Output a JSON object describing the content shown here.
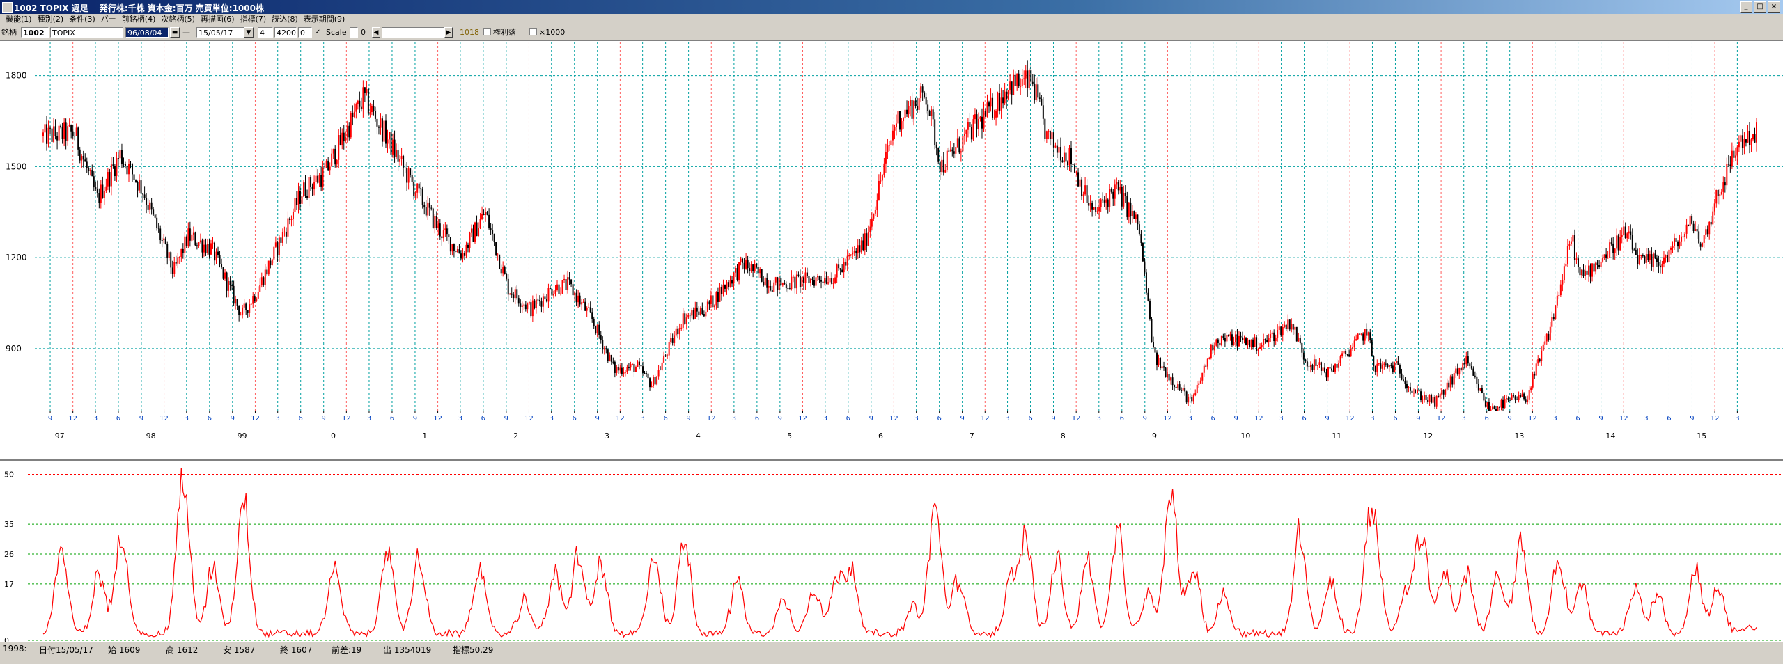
{
  "window": {
    "title": "1002 TOPIX 週足　 発行株:千株 資本金:百万 売買単位:1000株"
  },
  "menu": [
    "機能(1)",
    "種別(2)",
    "条件(3)",
    "バー",
    "前銘柄(4)",
    "次銘柄(5)",
    "再描画(6)",
    "指標(7)",
    "読込(8)",
    "表示期間(9)"
  ],
  "toolbar": {
    "code_label": "銘柄",
    "code": "1002",
    "name": "TOPIX",
    "start_date": "96/08/04",
    "end_date": "15/05/17",
    "field1": "4",
    "field2": "4200",
    "field3": "0",
    "scale_label": "Scale",
    "scale_value": "0",
    "count": "1018",
    "rights_label": "権利落",
    "x1000_label": "×1000"
  },
  "colors": {
    "up": "#ff0000",
    "down": "#000000",
    "grid_h": "#00a0a0",
    "grid_v": "#00a0a0",
    "sub_line": "#ff0000",
    "sub_grid": "#00a000",
    "sub_top_grid": "#ff0000"
  },
  "chart_data": [
    {
      "type": "candlestick",
      "title": "",
      "ylim": [
        700,
        1900
      ],
      "yticks": [
        900,
        1200,
        1500,
        1800
      ],
      "start_date": "1996-08-04",
      "end_date": "2015-05-17",
      "year_labels": [
        "97",
        "98",
        "99",
        "0",
        "1",
        "2",
        "3",
        "4",
        "5",
        "6",
        "7",
        "8",
        "9",
        "10",
        "11",
        "12",
        "13",
        "14",
        "15"
      ],
      "month_labels": [
        "9",
        "12",
        "3",
        "6"
      ],
      "keypoints": [
        [
          "1996-08",
          1600
        ],
        [
          "1996-12",
          1610
        ],
        [
          "1997-03",
          1390
        ],
        [
          "1997-06",
          1540
        ],
        [
          "1997-09",
          1420
        ],
        [
          "1998-01",
          1150
        ],
        [
          "1998-03",
          1270
        ],
        [
          "1998-06",
          1230
        ],
        [
          "1998-10",
          1010
        ],
        [
          "1998-12",
          1090
        ],
        [
          "1999-03",
          1250
        ],
        [
          "1999-06",
          1420
        ],
        [
          "1999-09",
          1480
        ],
        [
          "2000-02",
          1730
        ],
        [
          "2000-05",
          1600
        ],
        [
          "2000-08",
          1460
        ],
        [
          "2000-12",
          1290
        ],
        [
          "2001-03",
          1210
        ],
        [
          "2001-06",
          1350
        ],
        [
          "2001-09",
          1100
        ],
        [
          "2001-12",
          1030
        ],
        [
          "2002-03",
          1100
        ],
        [
          "2002-05",
          1110
        ],
        [
          "2002-08",
          1000
        ],
        [
          "2002-11",
          830
        ],
        [
          "2003-02",
          840
        ],
        [
          "2003-04",
          780
        ],
        [
          "2003-08",
          1000
        ],
        [
          "2003-11",
          1030
        ],
        [
          "2004-04",
          1180
        ],
        [
          "2004-08",
          1110
        ],
        [
          "2004-11",
          1120
        ],
        [
          "2005-04",
          1140
        ],
        [
          "2005-08",
          1250
        ],
        [
          "2005-12",
          1650
        ],
        [
          "2006-04",
          1740
        ],
        [
          "2006-06",
          1500
        ],
        [
          "2006-10",
          1620
        ],
        [
          "2007-01",
          1700
        ],
        [
          "2007-03",
          1770
        ],
        [
          "2007-06",
          1780
        ],
        [
          "2007-08",
          1590
        ],
        [
          "2007-11",
          1530
        ],
        [
          "2008-02",
          1340
        ],
        [
          "2008-05",
          1430
        ],
        [
          "2008-08",
          1300
        ],
        [
          "2008-10",
          870
        ],
        [
          "2009-03",
          720
        ],
        [
          "2009-06",
          930
        ],
        [
          "2009-09",
          930
        ],
        [
          "2009-12",
          910
        ],
        [
          "2010-04",
          990
        ],
        [
          "2010-06",
          860
        ],
        [
          "2010-09",
          820
        ],
        [
          "2011-02",
          960
        ],
        [
          "2011-03",
          840
        ],
        [
          "2011-06",
          840
        ],
        [
          "2011-08",
          760
        ],
        [
          "2011-11",
          720
        ],
        [
          "2012-03",
          860
        ],
        [
          "2012-06",
          700
        ],
        [
          "2012-09",
          730
        ],
        [
          "2012-11",
          740
        ],
        [
          "2013-02",
          960
        ],
        [
          "2013-05",
          1270
        ],
        [
          "2013-06",
          1130
        ],
        [
          "2013-09",
          1200
        ],
        [
          "2013-12",
          1280
        ],
        [
          "2014-02",
          1180
        ],
        [
          "2014-05",
          1190
        ],
        [
          "2014-09",
          1320
        ],
        [
          "2014-10",
          1230
        ],
        [
          "2014-12",
          1400
        ],
        [
          "2015-03",
          1580
        ],
        [
          "2015-05",
          1607
        ]
      ]
    },
    {
      "type": "line",
      "title": "",
      "ylim": [
        0,
        52
      ],
      "yticks": [
        0,
        17,
        26,
        35,
        50
      ],
      "peaks": [
        [
          "1996-10",
          25
        ],
        [
          "1997-03",
          18
        ],
        [
          "1997-06",
          30
        ],
        [
          "1998-02",
          49
        ],
        [
          "1998-06",
          20
        ],
        [
          "1998-10",
          41
        ],
        [
          "1999-10",
          21
        ],
        [
          "2000-05",
          25
        ],
        [
          "2000-09",
          23
        ],
        [
          "2001-05",
          20
        ],
        [
          "2001-11",
          10
        ],
        [
          "2002-03",
          18
        ],
        [
          "2002-06",
          24
        ],
        [
          "2002-09",
          21
        ],
        [
          "2003-04",
          24
        ],
        [
          "2003-08",
          29
        ],
        [
          "2004-03",
          16
        ],
        [
          "2004-09",
          10
        ],
        [
          "2005-01",
          14
        ],
        [
          "2005-04",
          16
        ],
        [
          "2005-06",
          20
        ],
        [
          "2006-02",
          8
        ],
        [
          "2006-05",
          38
        ],
        [
          "2006-08",
          16
        ],
        [
          "2007-03",
          16
        ],
        [
          "2007-05",
          28
        ],
        [
          "2007-09",
          23
        ],
        [
          "2008-01",
          22
        ],
        [
          "2008-05",
          30
        ],
        [
          "2008-09",
          12
        ],
        [
          "2008-12",
          43
        ],
        [
          "2009-03",
          20
        ],
        [
          "2009-07",
          12
        ],
        [
          "2010-05",
          31
        ],
        [
          "2010-09",
          16
        ],
        [
          "2011-02",
          24
        ],
        [
          "2011-03",
          21
        ],
        [
          "2011-07",
          12
        ],
        [
          "2011-09",
          31
        ],
        [
          "2011-12",
          19
        ],
        [
          "2012-03",
          18
        ],
        [
          "2012-07",
          17
        ],
        [
          "2012-10",
          28
        ],
        [
          "2013-03",
          23
        ],
        [
          "2013-06",
          15
        ],
        [
          "2014-01",
          13
        ],
        [
          "2014-04",
          12
        ],
        [
          "2014-09",
          19
        ],
        [
          "2014-12",
          13
        ],
        [
          "2015-04",
          2
        ]
      ]
    }
  ],
  "status": {
    "item1": "1998:",
    "date": "日付15/05/17",
    "open": "始 1609",
    "high": "高 1612",
    "low": "安 1587",
    "close": "終 1607",
    "diff": "前差:19",
    "volume": "出 1354019",
    "indicator": "指標50.29"
  }
}
